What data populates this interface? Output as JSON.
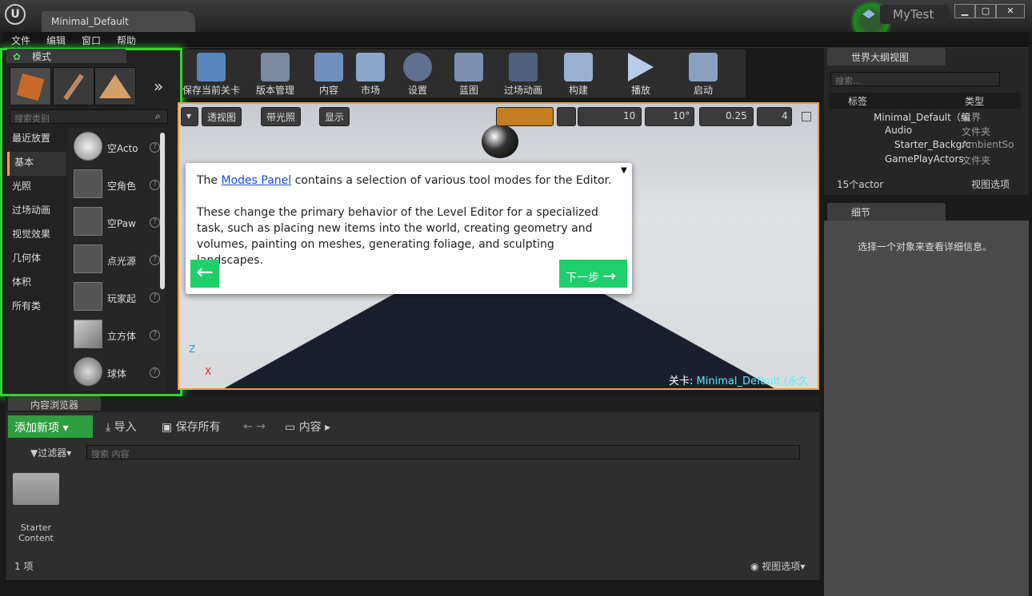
{
  "window": {
    "doc_tab": "Minimal_Default",
    "project": "MyTest",
    "min_btn": "▁",
    "max_btn": "▢",
    "close_btn": "✕"
  },
  "menu": [
    "文件",
    "编辑",
    "窗口",
    "帮助"
  ],
  "modes": {
    "title": "模式",
    "search_placeholder": "搜索类别",
    "categories": [
      "最近放置",
      "基本",
      "光照",
      "过场动画",
      "视觉效果",
      "几何体",
      "体积",
      "所有类"
    ],
    "items": [
      "空Acto",
      "空角色",
      "空Paw",
      "点光源",
      "玩家起",
      "立方体",
      "球体"
    ]
  },
  "toolbar": [
    "保存当前关卡",
    "版本管理",
    "内容",
    "市场",
    "设置",
    "蓝图",
    "过场动画",
    "构建",
    "播放",
    "启动"
  ],
  "viewport": {
    "perspective": "透视图",
    "lit": "带光照",
    "show": "显示",
    "grid_snap": "10",
    "rot_snap": "10°",
    "scale_snap": "0.25",
    "cam_speed": "4",
    "level_label": "关卡:",
    "level_name": "Minimal_Default (永久性)",
    "axis_z": "Z",
    "axis_x": "X"
  },
  "tip": {
    "p1_pre": "The",
    "p1_link": "Modes Panel",
    "p1_post": "contains a selection of various tool modes for the Editor.",
    "p2": "These change the primary behavior of the Level Editor for a specialized task, such as placing new items into the world, creating geometry and volumes, painting on meshes, generating foliage, and sculpting landscapes.",
    "back": "←",
    "next": "下一步"
  },
  "outliner": {
    "title": "世界大纲视图",
    "search_placeholder": "搜索...",
    "col_label": "标签",
    "col_type": "类型",
    "rows": [
      {
        "label": "Minimal_Default（编",
        "type": "世界"
      },
      {
        "label": "Audio",
        "type": "文件夹"
      },
      {
        "label": "Starter_Backgrc",
        "type": "AmbientSo"
      },
      {
        "label": "GamePlayActors",
        "type": "文件夹"
      }
    ],
    "count": "15个actor",
    "view_options": "视图选项"
  },
  "details": {
    "title": "细节",
    "empty_msg": "选择一个对象来查看详细信息。"
  },
  "content_browser": {
    "title": "内容浏览器",
    "add_new": "添加新项",
    "import": "导入",
    "save_all": "保存所有",
    "path": "内容",
    "filters": "过滤器",
    "search_placeholder": "搜索 内容",
    "folder_name": "Starter Content",
    "item_count": "1 项",
    "view_options": "视图选项"
  },
  "colors": {
    "highlight": "#2fd62f",
    "accent": "#e8a13c",
    "tip_button": "#1ecf6b"
  }
}
